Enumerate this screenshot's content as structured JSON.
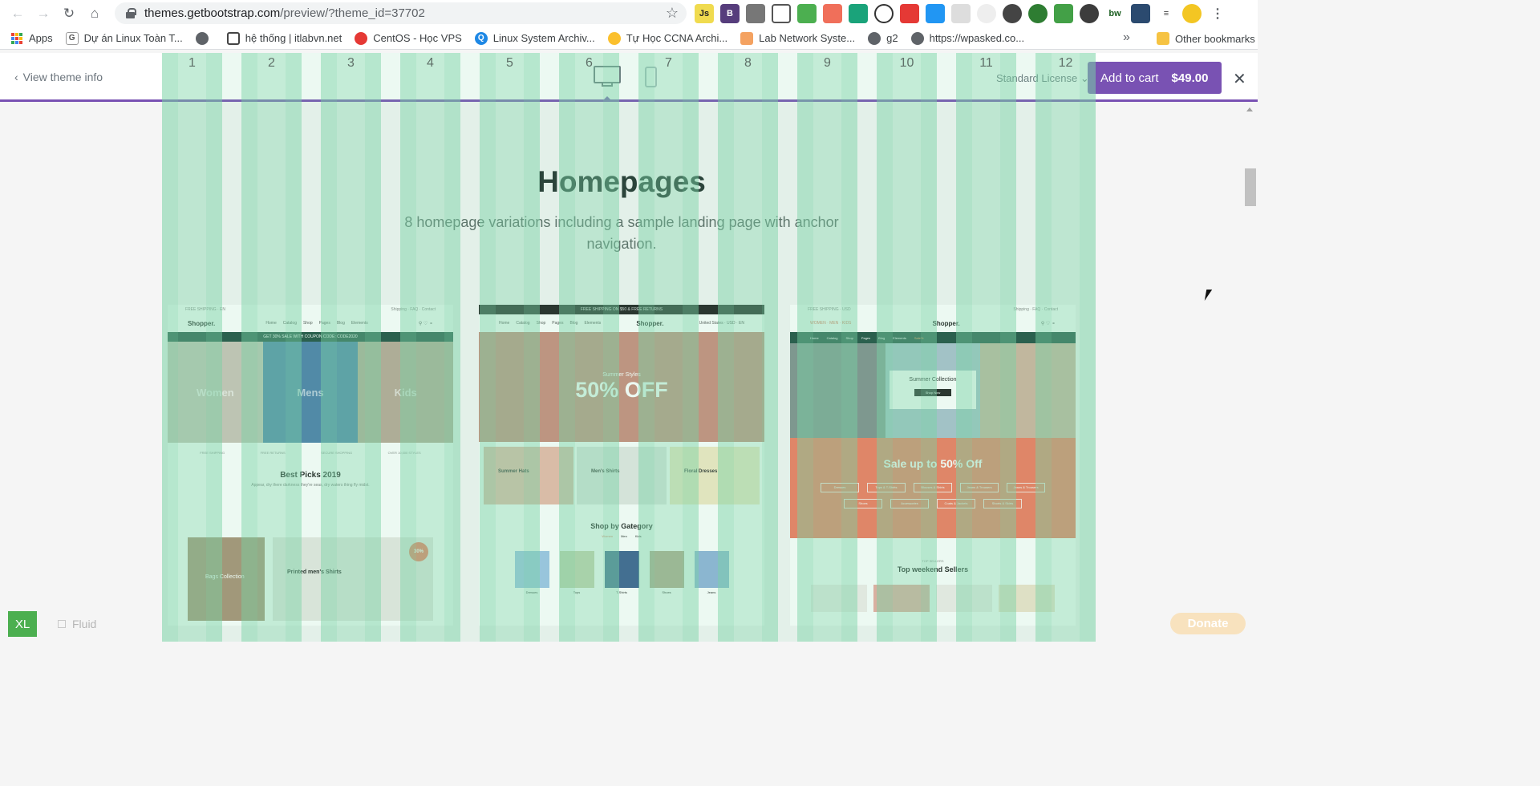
{
  "browser": {
    "url_host": "themes.getbootstrap.com",
    "url_path": "/preview/?theme_id=37702",
    "extensions": [
      "Js",
      "B",
      "",
      "",
      "",
      "",
      "",
      "",
      "",
      "",
      "",
      "",
      "",
      "",
      "",
      "",
      "",
      "bw",
      "",
      "",
      ""
    ]
  },
  "bookmarks": {
    "items": [
      {
        "label": "Apps",
        "icon": "apps-grid-icon"
      },
      {
        "label": "Dự án Linux Toàn T...",
        "icon": "g-icon"
      },
      {
        "label": "",
        "icon": "globe-icon"
      },
      {
        "label": "hệ thống | itlabvn.net",
        "icon": "monitor-icon"
      },
      {
        "label": "CentOS - Học VPS",
        "icon": "cloud-icon"
      },
      {
        "label": "Linux System Archiv...",
        "icon": "q-icon"
      },
      {
        "label": "Tự Học CCNA Archi...",
        "icon": "cisco-icon"
      },
      {
        "label": "Lab Network Syste...",
        "icon": "network-icon"
      },
      {
        "label": "g2",
        "icon": "globe-icon"
      },
      {
        "label": "https://wpasked.co...",
        "icon": "globe-icon"
      }
    ],
    "more": "»",
    "other": "Other bookmarks"
  },
  "theme_bar": {
    "view_info": "View theme info",
    "license": "Standard License",
    "cart_label": "Add to cart",
    "price": "$49.00"
  },
  "grid_columns": [
    "1",
    "2",
    "3",
    "4",
    "5",
    "6",
    "7",
    "8",
    "9",
    "10",
    "11",
    "12"
  ],
  "section": {
    "title": "Homepages",
    "subtitle": "8 homepage variations including a sample landing page with anchor navigation."
  },
  "cards": [
    {
      "promo": "GET 30% SALE WITH COUPON CODE: CODE2020",
      "brand": "Shopper.",
      "nav": [
        "Home",
        "Catalog",
        "Shop",
        "Pages",
        "Blog",
        "Elements"
      ],
      "hero": [
        "Women",
        "Mens",
        "Kids"
      ],
      "features": [
        "FREE SHIPPING",
        "FREE RETURNS",
        "SECURE SHOPPING",
        "OVER 10,000 STYLES"
      ],
      "best_picks": "Best Picks 2019",
      "best_picks_sub": "Appear, dry there darkness they're seas, dry waters thing fly midst.",
      "bottom": [
        "Bags Collection",
        "Printed men's Shirts"
      ],
      "badge": "30%"
    },
    {
      "topline": "FREE SHIPPING ON $50 & FREE RETURNS",
      "brand": "Shopper.",
      "nav": [
        "Home",
        "Catalog",
        "Shop",
        "Pages",
        "Blog",
        "Elements"
      ],
      "hero_small": "Summer Styles",
      "hero_big": "50% OFF",
      "tiles": [
        "Summer Hats",
        "Men's Shirts",
        "Floral Dresses"
      ],
      "category_title": "Shop by Gategory",
      "category_tabs": [
        "Women",
        "Men",
        "Kids"
      ],
      "categories": [
        "Dresses",
        "Tops",
        "T-Shirts",
        "Shoes",
        "Jeans"
      ]
    },
    {
      "brand": "Shopper.",
      "nav": [
        "Home",
        "Catalog",
        "Shop",
        "Pages",
        "Blog",
        "Elements",
        "Sale%"
      ],
      "summer_title": "Summer Collection",
      "summer_btn": "Shop Now",
      "sale_title": "Sale up to 50% Off",
      "sale_chips": [
        "Dresses",
        "Tops & T-Shirts",
        "Blouses & Shirts",
        "Jeans & Trousers",
        "Jeans & Trousers",
        "Shoes",
        "Accessories",
        "Coats & Jackets",
        "Shorts & Skirts"
      ],
      "sellers_title": "Top weekend Sellers"
    }
  ],
  "bottom_bar": {
    "breakpoint": "XL",
    "fluid_label": "Fluid",
    "donate": "Donate"
  }
}
